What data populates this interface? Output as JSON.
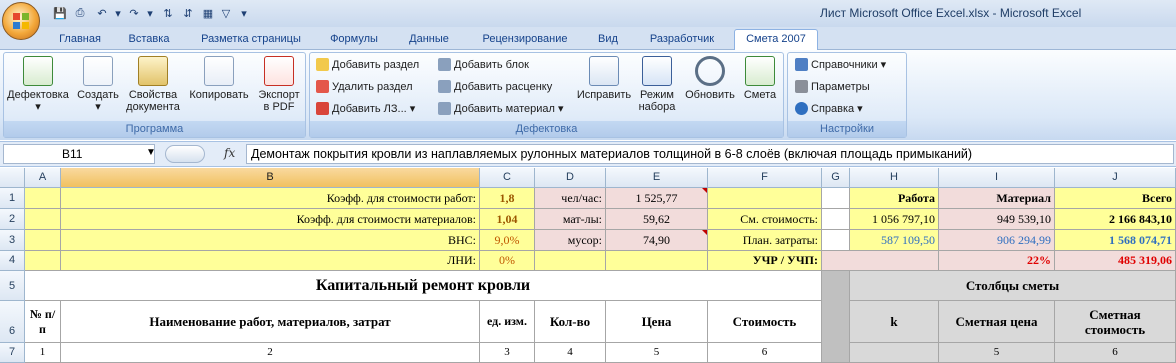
{
  "window": {
    "title": "Лист Microsoft Office Excel.xlsx - Microsoft Excel"
  },
  "tabs": [
    "Главная",
    "Вставка",
    "Разметка страницы",
    "Формулы",
    "Данные",
    "Рецензирование",
    "Вид",
    "Разработчик",
    "Смета 2007"
  ],
  "ribbon": {
    "programma": {
      "title": "Программа",
      "buttons": [
        "Дефектовка",
        "Создать",
        "Свойства документа",
        "Копировать",
        "Экспорт в PDF"
      ]
    },
    "defektovka": {
      "title": "Дефектовка",
      "small": [
        "Добавить раздел",
        "Удалить раздел",
        "Добавить ЛЗ...",
        "Добавить блок",
        "Добавить расценку",
        "Добавить материал"
      ],
      "buttons": [
        "Исправить",
        "Режим набора",
        "Обновить",
        "Смета"
      ]
    },
    "nastroyki": {
      "title": "Настройки",
      "small": [
        "Справочники",
        "Параметры",
        "Справка"
      ]
    }
  },
  "formula_bar": {
    "cell": "B11",
    "fx": "fx",
    "content": "Демонтаж покрытия кровли из наплавляемых рулонных материалов толщиной в 6-8 слоёв (включая площадь примыканий)"
  },
  "columns": [
    "A",
    "B",
    "C",
    "D",
    "E",
    "F",
    "G",
    "H",
    "I",
    "J"
  ],
  "rows": [
    "1",
    "2",
    "3",
    "4",
    "5",
    "6",
    "7"
  ],
  "sheet": {
    "r1": {
      "b": "Коэфф. для стоимости работ:",
      "c": "1,8",
      "d": "чел/час:",
      "e": "1 525,77",
      "h": "Работа",
      "i": "Материал",
      "j": "Всего"
    },
    "r2": {
      "b": "Коэфф. для стоимости материалов:",
      "c": "1,04",
      "d": "мат-лы:",
      "e": "59,62",
      "f": "См. стоимость:",
      "h": "1 056 797,10",
      "i": "949 539,10",
      "j": "2 166 843,10"
    },
    "r3": {
      "b": "ВНС:",
      "c": "9,0%",
      "d": "мусор:",
      "e": "74,90",
      "f": "План. затраты:",
      "h": "587 109,50",
      "i": "906 294,99",
      "j": "1 568 074,71"
    },
    "r4": {
      "b": "ЛНИ:",
      "c": "0%",
      "f": "УЧР / УЧП:",
      "i": "22%",
      "j": "485 319,06"
    },
    "r5": {
      "title": "Капитальный ремонт кровли",
      "estimate_cols": "Столбцы сметы"
    },
    "r6": {
      "a": "№ п/п",
      "b": "Наименование работ, материалов, затрат",
      "c": "ед. изм.",
      "d": "Кол-во",
      "e": "Цена",
      "f": "Стоимость",
      "h": "k",
      "i": "Сметная цена",
      "j": "Сметная стоимость"
    },
    "r7": {
      "a": "1",
      "b": "2",
      "c": "3",
      "d": "4",
      "e": "5",
      "f": "6",
      "i": "5",
      "j": "6"
    }
  }
}
